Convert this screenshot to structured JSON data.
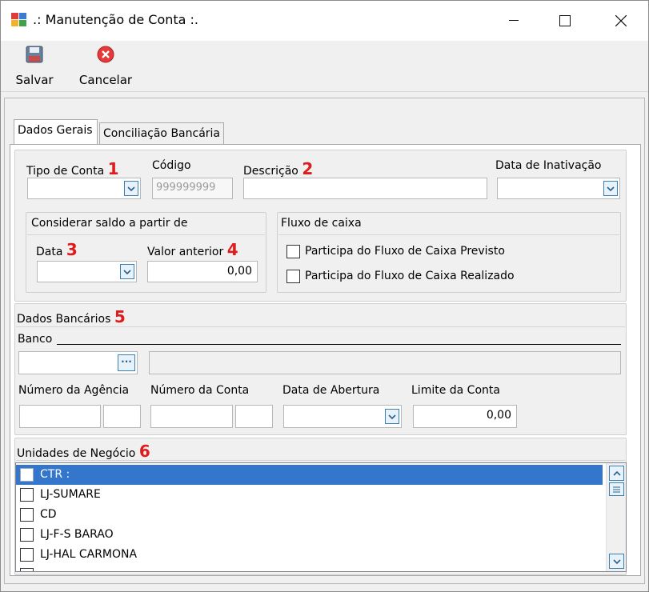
{
  "window": {
    "title": ".: Manutenção de Conta :."
  },
  "toolbar": {
    "save_label": "Salvar",
    "cancel_label": "Cancelar"
  },
  "tabs": [
    {
      "label": "Dados Gerais"
    },
    {
      "label": "Conciliação Bancária"
    }
  ],
  "general": {
    "tipo_conta_label": "Tipo de Conta",
    "marker1": "1",
    "codigo_label": "Código",
    "codigo_value": "999999999",
    "descricao_label": "Descrição",
    "marker2": "2",
    "data_inativacao_label": "Data de Inativação",
    "saldo_group_title": "Considerar saldo a partir de",
    "data_label": "Data",
    "marker3": "3",
    "valor_anterior_label": "Valor anterior",
    "marker4": "4",
    "valor_anterior_value": "0,00",
    "fluxo_group_title": "Fluxo de caixa",
    "fluxo_previsto_label": "Participa do Fluxo de Caixa Previsto",
    "fluxo_realizado_label": "Participa do Fluxo de Caixa Realizado"
  },
  "bank": {
    "group_title": "Dados Bancários",
    "marker5": "5",
    "banco_label": "Banco",
    "browse_label": "···",
    "agencia_label": "Número da Agência",
    "conta_label": "Número da Conta",
    "abertura_label": "Data de Abertura",
    "limite_label": "Limite da Conta",
    "limite_value": "0,00"
  },
  "units": {
    "group_title": "Unidades de Negócio",
    "marker6": "6",
    "items": [
      {
        "label": "CTR :"
      },
      {
        "label": "LJ-SUMARE"
      },
      {
        "label": "CD"
      },
      {
        "label": "LJ-F-S BARAO"
      },
      {
        "label": "LJ-HAL CARMONA"
      }
    ]
  },
  "colors": {
    "selection": "#3376cc",
    "marker": "#e01b1b",
    "accent": "#3c7fb1"
  }
}
